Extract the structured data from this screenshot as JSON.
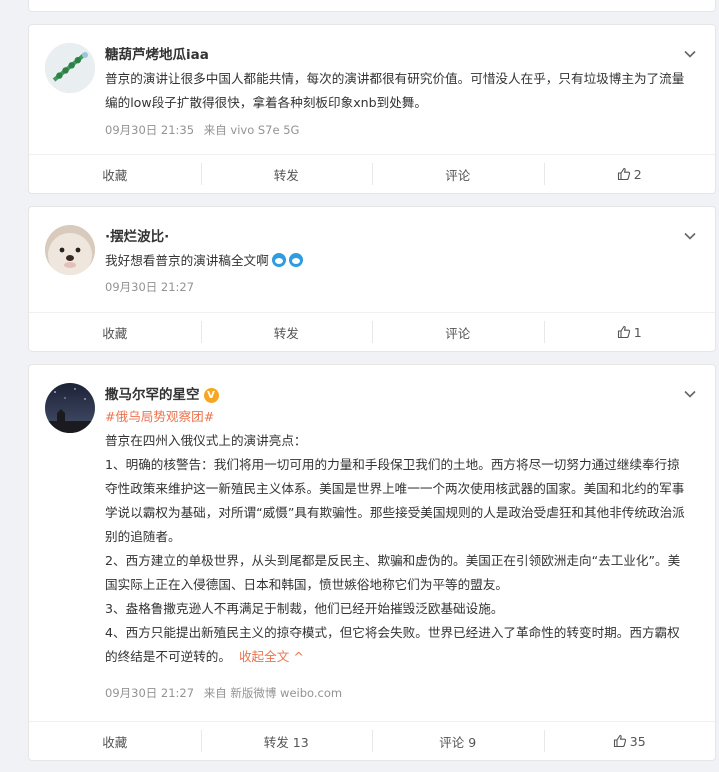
{
  "posts": [
    {
      "username": "糖葫芦烤地瓜iaa",
      "paragraphs": [
        "普京的演讲让很多中国人都能共情，每次的演讲都很有研究价值。可惜没人在乎，只有垃圾博主为了流量编的low段子扩散得很快，拿着各种刻板印象xnb到处舞。"
      ],
      "time": "09月30日 21:35",
      "source": "来自 vivo S7e 5G",
      "actions": {
        "favorite": "收藏",
        "repost": "转发",
        "comment": "评论",
        "like_count": "2"
      }
    },
    {
      "username": "·摆烂波比·",
      "paragraphs": [
        "我好想看普京的演讲稿全文啊"
      ],
      "time": "09月30日 21:27",
      "source": "",
      "actions": {
        "favorite": "收藏",
        "repost": "转发",
        "comment": "评论",
        "like_count": "1"
      }
    },
    {
      "username": "撒马尔罕的星空",
      "verified_badge": "V",
      "topic": "#俄乌局势观察团#",
      "paragraphs": [
        "普京在四州入俄仪式上的演讲亮点：",
        "1、明确的核警告：我们将用一切可用的力量和手段保卫我们的土地。西方将尽一切努力通过继续奉行掠夺性政策来维护这一新殖民主义体系。美国是世界上唯一一个两次使用核武器的国家。美国和北约的军事学说以霸权为基础，对所谓“威慑”具有欺骗性。那些接受美国规则的人是政治受虐狂和其他非传统政治派别的追随者。",
        "2、西方建立的单极世界，从头到尾都是反民主、欺骗和虚伪的。美国正在引领欧洲走向“去工业化”。美国实际上正在入侵德国、日本和韩国，愤世嫉俗地称它们为平等的盟友。",
        "3、盎格鲁撒克逊人不再满足于制裁，他们已经开始摧毁泛欧基础设施。",
        "4、西方只能提出新殖民主义的掠夺模式，但它将会失败。世界已经进入了革命性的转变时期。西方霸权的终结是不可逆转的。"
      ],
      "collapse_label": "收起全文 ^",
      "time": "09月30日 21:27",
      "source": "来自 新版微博 weibo.com",
      "actions": {
        "favorite": "收藏",
        "repost": "转发 13",
        "comment": "评论 9",
        "like_count": "35"
      }
    }
  ]
}
